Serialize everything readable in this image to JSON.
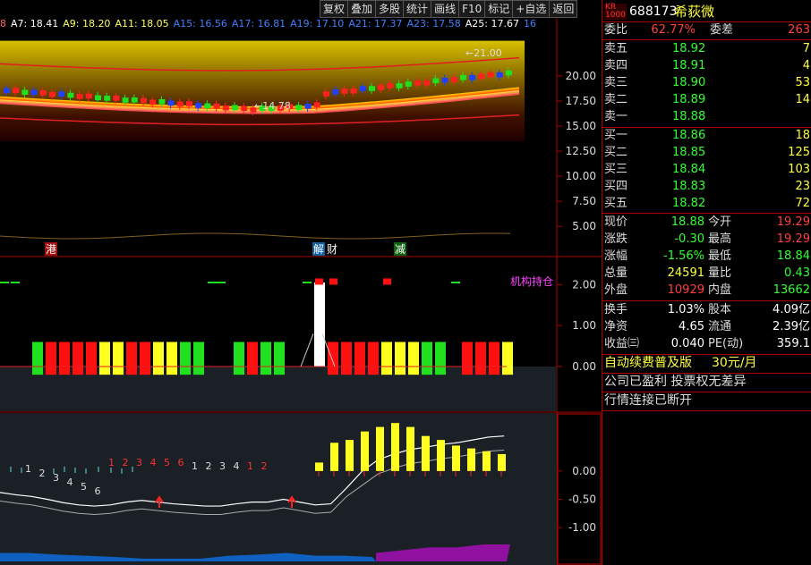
{
  "toolbar": [
    "复权",
    "叠加",
    "多股",
    "统计",
    "画线",
    "F10",
    "标记",
    "+自选",
    "返回"
  ],
  "ma_legend": [
    {
      "text": "8",
      "color": "#ff6060"
    },
    {
      "text": "A7: 18.41",
      "color": "#ffffff"
    },
    {
      "text": "A9: 18.20",
      "color": "#ffff60"
    },
    {
      "text": "A11: 18.05",
      "color": "#ffff60"
    },
    {
      "text": "A15: 16.56",
      "color": "#4080ff"
    },
    {
      "text": "A17: 16.81",
      "color": "#4080ff"
    },
    {
      "text": "A19: 17.10",
      "color": "#4080ff"
    },
    {
      "text": "A21: 17.37",
      "color": "#4080ff"
    },
    {
      "text": "A23: 17.58",
      "color": "#4080ff"
    },
    {
      "text": "A25: 17.67",
      "color": "#ffffff"
    },
    {
      "text": "16",
      "color": "#4080ff"
    }
  ],
  "chart_data": [
    {
      "type": "candlestick",
      "title": "",
      "y_ticks": [
        "20.00",
        "17.50",
        "15.00",
        "12.50",
        "10.00",
        "7.50",
        "5.00"
      ],
      "ylim": [
        3.5,
        24
      ],
      "annotations": {
        "high": "21.00",
        "low": "14.78"
      },
      "event_labels": [
        {
          "text": "港",
          "bg": "#a01010",
          "color": "#ffffff"
        },
        {
          "text": "解",
          "bg": "#1060a0",
          "color": "#ffffff"
        },
        {
          "text": "财",
          "bg": "#000000",
          "color": "#ffffff"
        },
        {
          "text": "减",
          "bg": "#106010",
          "color": "#ffffff"
        }
      ]
    },
    {
      "type": "bar",
      "title": "机构持仓",
      "y_ticks": [
        "2.00",
        "1.00",
        "0.00"
      ],
      "ylim": [
        0,
        2.4
      ],
      "colors": [
        "G",
        "R",
        "R",
        "R",
        "R",
        "Y",
        "Y",
        "R",
        "R",
        "Y",
        "Y",
        "G",
        "G",
        "_",
        "_",
        "G",
        "R",
        "G",
        "G",
        "_",
        "_",
        "W",
        "R",
        "R",
        "R",
        "R",
        "Y",
        "Y",
        "Y",
        "G",
        "G",
        "_",
        "R",
        "R",
        "R",
        "Y"
      ],
      "value": 0.8
    },
    {
      "type": "bar",
      "y_ticks": [
        "0.00",
        "-0.50",
        "-1.00"
      ],
      "ylim": [
        -1.6,
        0.9
      ],
      "count_labels": [
        "1",
        "2",
        "3",
        "4",
        "5",
        "6",
        "1",
        "2",
        "3",
        "4",
        "5",
        "6",
        "1",
        "2",
        "3",
        "4",
        "1",
        "2"
      ],
      "bars": [
        0.15,
        0.5,
        0.55,
        0.7,
        0.78,
        0.85,
        0.78,
        0.62,
        0.55,
        0.45,
        0.4,
        0.35,
        0.3
      ],
      "line_white": [
        -0.38,
        -0.42,
        -0.45,
        -0.5,
        -0.56,
        -0.6,
        -0.62,
        -0.6,
        -0.55,
        -0.52,
        -0.55,
        -0.58,
        -0.6,
        -0.62,
        -0.62,
        -0.58,
        -0.55,
        -0.55,
        -0.5,
        -0.55,
        -0.6,
        -0.58,
        -0.3,
        0.0,
        0.2,
        0.3,
        0.38,
        0.42,
        0.47,
        0.5,
        0.55,
        0.6,
        0.62
      ],
      "area_blue": [
        -1.45,
        -1.45,
        -1.48,
        -1.5,
        -1.52,
        -1.55,
        -1.55,
        -1.55,
        -1.5,
        -1.48,
        -1.45,
        -1.5,
        -1.5,
        -1.52
      ],
      "area_purple": [
        -1.45,
        -1.4,
        -1.35,
        -1.35,
        -1.3,
        -1.3
      ]
    }
  ],
  "quote": {
    "code": "688173",
    "name": "希荻微",
    "weibi_label": "委比",
    "weibi": "62.77%",
    "weicha_label": "委差",
    "weicha": "263",
    "asks": [
      {
        "label": "卖五",
        "price": "18.92",
        "vol": "7"
      },
      {
        "label": "卖四",
        "price": "18.91",
        "vol": "4"
      },
      {
        "label": "卖三",
        "price": "18.90",
        "vol": "53"
      },
      {
        "label": "卖二",
        "price": "18.89",
        "vol": "14"
      },
      {
        "label": "卖一",
        "price": "18.88",
        "vol": ""
      }
    ],
    "bids": [
      {
        "label": "买一",
        "price": "18.86",
        "vol": "18"
      },
      {
        "label": "买二",
        "price": "18.85",
        "vol": "125"
      },
      {
        "label": "买三",
        "price": "18.84",
        "vol": "103"
      },
      {
        "label": "买四",
        "price": "18.83",
        "vol": "23"
      },
      {
        "label": "买五",
        "price": "18.82",
        "vol": "72"
      }
    ],
    "stats": [
      {
        "l1": "现价",
        "v1": "18.88",
        "c1": "grn",
        "l2": "今开",
        "v2": "19.29",
        "c2": "red"
      },
      {
        "l1": "涨跌",
        "v1": "-0.30",
        "c1": "grn",
        "l2": "最高",
        "v2": "19.29",
        "c2": "red"
      },
      {
        "l1": "涨幅",
        "v1": "-1.56%",
        "c1": "grn",
        "l2": "最低",
        "v2": "18.84",
        "c2": "grn"
      },
      {
        "l1": "总量",
        "v1": "24591",
        "c1": "yel",
        "l2": "量比",
        "v2": "0.43",
        "c2": "grn"
      },
      {
        "l1": "外盘",
        "v1": "10929",
        "c1": "red",
        "l2": "内盘",
        "v2": "13662",
        "c2": "grn"
      }
    ],
    "finance": [
      {
        "l1": "换手",
        "v1": "1.03%",
        "l2": "股本",
        "v2": "4.09亿"
      },
      {
        "l1": "净资",
        "v1": "4.65",
        "l2": "流通",
        "v2": "2.39亿"
      },
      {
        "l1": "收益㈢",
        "v1": "0.040",
        "l2": "PE(动)",
        "v2": "359.1"
      }
    ],
    "promo": "自动续费普及版",
    "promo_price": "30元/月",
    "notice": "公司已盈利 投票权无差异",
    "status": "行情连接已断开"
  }
}
